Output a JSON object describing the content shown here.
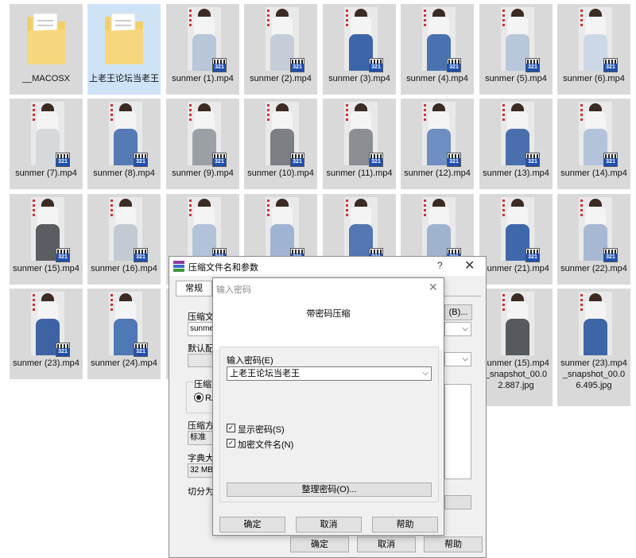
{
  "files": [
    {
      "name": "__MACOSX",
      "type": "folder"
    },
    {
      "name": "上老王论坛当老王",
      "type": "folder",
      "selected": true
    },
    {
      "name": "sunmer (1).mp4",
      "type": "video",
      "pants": "#b7c6d9"
    },
    {
      "name": "sunmer (2).mp4",
      "type": "video",
      "pants": "#c5cdd8"
    },
    {
      "name": "sunmer (3).mp4",
      "type": "video",
      "pants": "#3d66a8"
    },
    {
      "name": "sunmer (4).mp4",
      "type": "video",
      "pants": "#4a72b0"
    },
    {
      "name": "sunmer (5).mp4",
      "type": "video",
      "pants": "#b9c7da"
    },
    {
      "name": "sunmer (6).mp4",
      "type": "video",
      "pants": "#cdd8e6"
    },
    {
      "name": "sunmer (7).mp4",
      "type": "video",
      "pants": "#d6d9dc"
    },
    {
      "name": "sunmer (8).mp4",
      "type": "video",
      "pants": "#557bb6"
    },
    {
      "name": "sunmer (9).mp4",
      "type": "video",
      "pants": "#9aa0a6"
    },
    {
      "name": "sunmer (10).mp4",
      "type": "video",
      "pants": "#7c8086"
    },
    {
      "name": "sunmer (11).mp4",
      "type": "video",
      "pants": "#8b8f95"
    },
    {
      "name": "sunmer (12).mp4",
      "type": "video",
      "pants": "#6f8fc2"
    },
    {
      "name": "sunmer (13).mp4",
      "type": "video",
      "pants": "#4a6fae"
    },
    {
      "name": "sunmer (14).mp4",
      "type": "video",
      "pants": "#b3c3da"
    },
    {
      "name": "sunmer (15).mp4",
      "type": "video",
      "pants": "#5a5d62"
    },
    {
      "name": "sunmer (16).mp4",
      "type": "video",
      "pants": "#c4cad3"
    },
    {
      "name": "",
      "type": "video",
      "pants": "#b2c2d8"
    },
    {
      "name": "",
      "type": "video",
      "pants": "#9fb4d2"
    },
    {
      "name": "",
      "type": "video",
      "pants": "#5277b3"
    },
    {
      "name": "",
      "type": "video",
      "pants": "#9fb3cf"
    },
    {
      "name": "sunmer (21).mp4",
      "type": "video",
      "pants": "#3f68ab"
    },
    {
      "name": "sunmer (22).mp4",
      "type": "video",
      "pants": "#a7b9d2"
    },
    {
      "name": "sunmer (23).mp4",
      "type": "video",
      "pants": "#3d63a4"
    },
    {
      "name": "sunmer (24).mp4",
      "type": "video",
      "pants": "#4f78b6"
    },
    {
      "name": "",
      "type": "video",
      "pants": "#8a8e94"
    },
    {
      "name": "",
      "type": "video",
      "pants": "#8a8e94"
    },
    {
      "name": "",
      "type": "video",
      "pants": "#8a8e94"
    },
    {
      "name": "",
      "type": "video",
      "pants": "#8a8e94"
    },
    {
      "name": "sunmer (15).mp4_snapshot_00.02.887.jpg",
      "type": "image",
      "pants": "#56595e"
    },
    {
      "name": "sunmer (23).mp4_snapshot_00.06.495.jpg",
      "type": "image",
      "pants": "#3e65a6"
    }
  ],
  "outer_dialog": {
    "title": "压缩文件名和参数",
    "help": "?",
    "close": "✕",
    "tab_general": "常规",
    "archive_name_label": "压缩文",
    "archive_name_value": "sunmer",
    "browse_button": "(B)...",
    "default_profile_label": "默认配",
    "format_label": "压缩文",
    "format_rar": "RA",
    "method_label": "压缩方",
    "method_value": "标准",
    "dict_label": "字典大",
    "dict_value": "32 MB",
    "split_label": "切分为",
    "ok": "确定",
    "cancel": "取消",
    "help_btn": "帮助"
  },
  "inner_dialog": {
    "title": "输入密码",
    "close": "✕",
    "heading": "带密码压缩",
    "password_label": "输入密码(E)",
    "password_value": "上老王论坛当老王",
    "show_password_label": "显示密码(S)",
    "show_password_checked": true,
    "encrypt_names_label": "加密文件名(N)",
    "encrypt_names_checked": true,
    "organize_button": "整理密码(O)...",
    "ok": "确定",
    "cancel": "取消",
    "help": "帮助"
  },
  "colors": {
    "tile_bg": "#d9d9d9",
    "folder": "#f3cf6b",
    "badge_blue": "#1e4fae",
    "dialog_bg": "#f0f0f0"
  },
  "icons": {
    "folder": "folder-icon",
    "video_badge": "video-player-badge-icon",
    "app": "winrar-icon"
  }
}
